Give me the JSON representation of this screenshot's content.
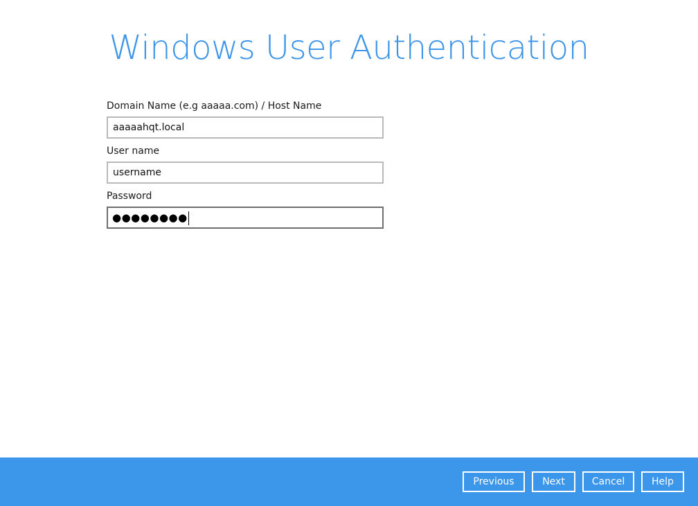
{
  "page": {
    "title": "Windows User Authentication"
  },
  "form": {
    "domain": {
      "label": "Domain Name (e.g  aaaaa.com) / Host Name",
      "value": "aaaaahqt.local"
    },
    "username": {
      "label": "User name",
      "value": "username"
    },
    "password": {
      "label": "Password",
      "masked_value": "●●●●●●●●"
    }
  },
  "footer": {
    "previous_label": "Previous",
    "next_label": "Next",
    "cancel_label": "Cancel",
    "help_label": "Help"
  },
  "colors": {
    "accent": "#3c94e8",
    "footer_background": "#3c96ea"
  }
}
